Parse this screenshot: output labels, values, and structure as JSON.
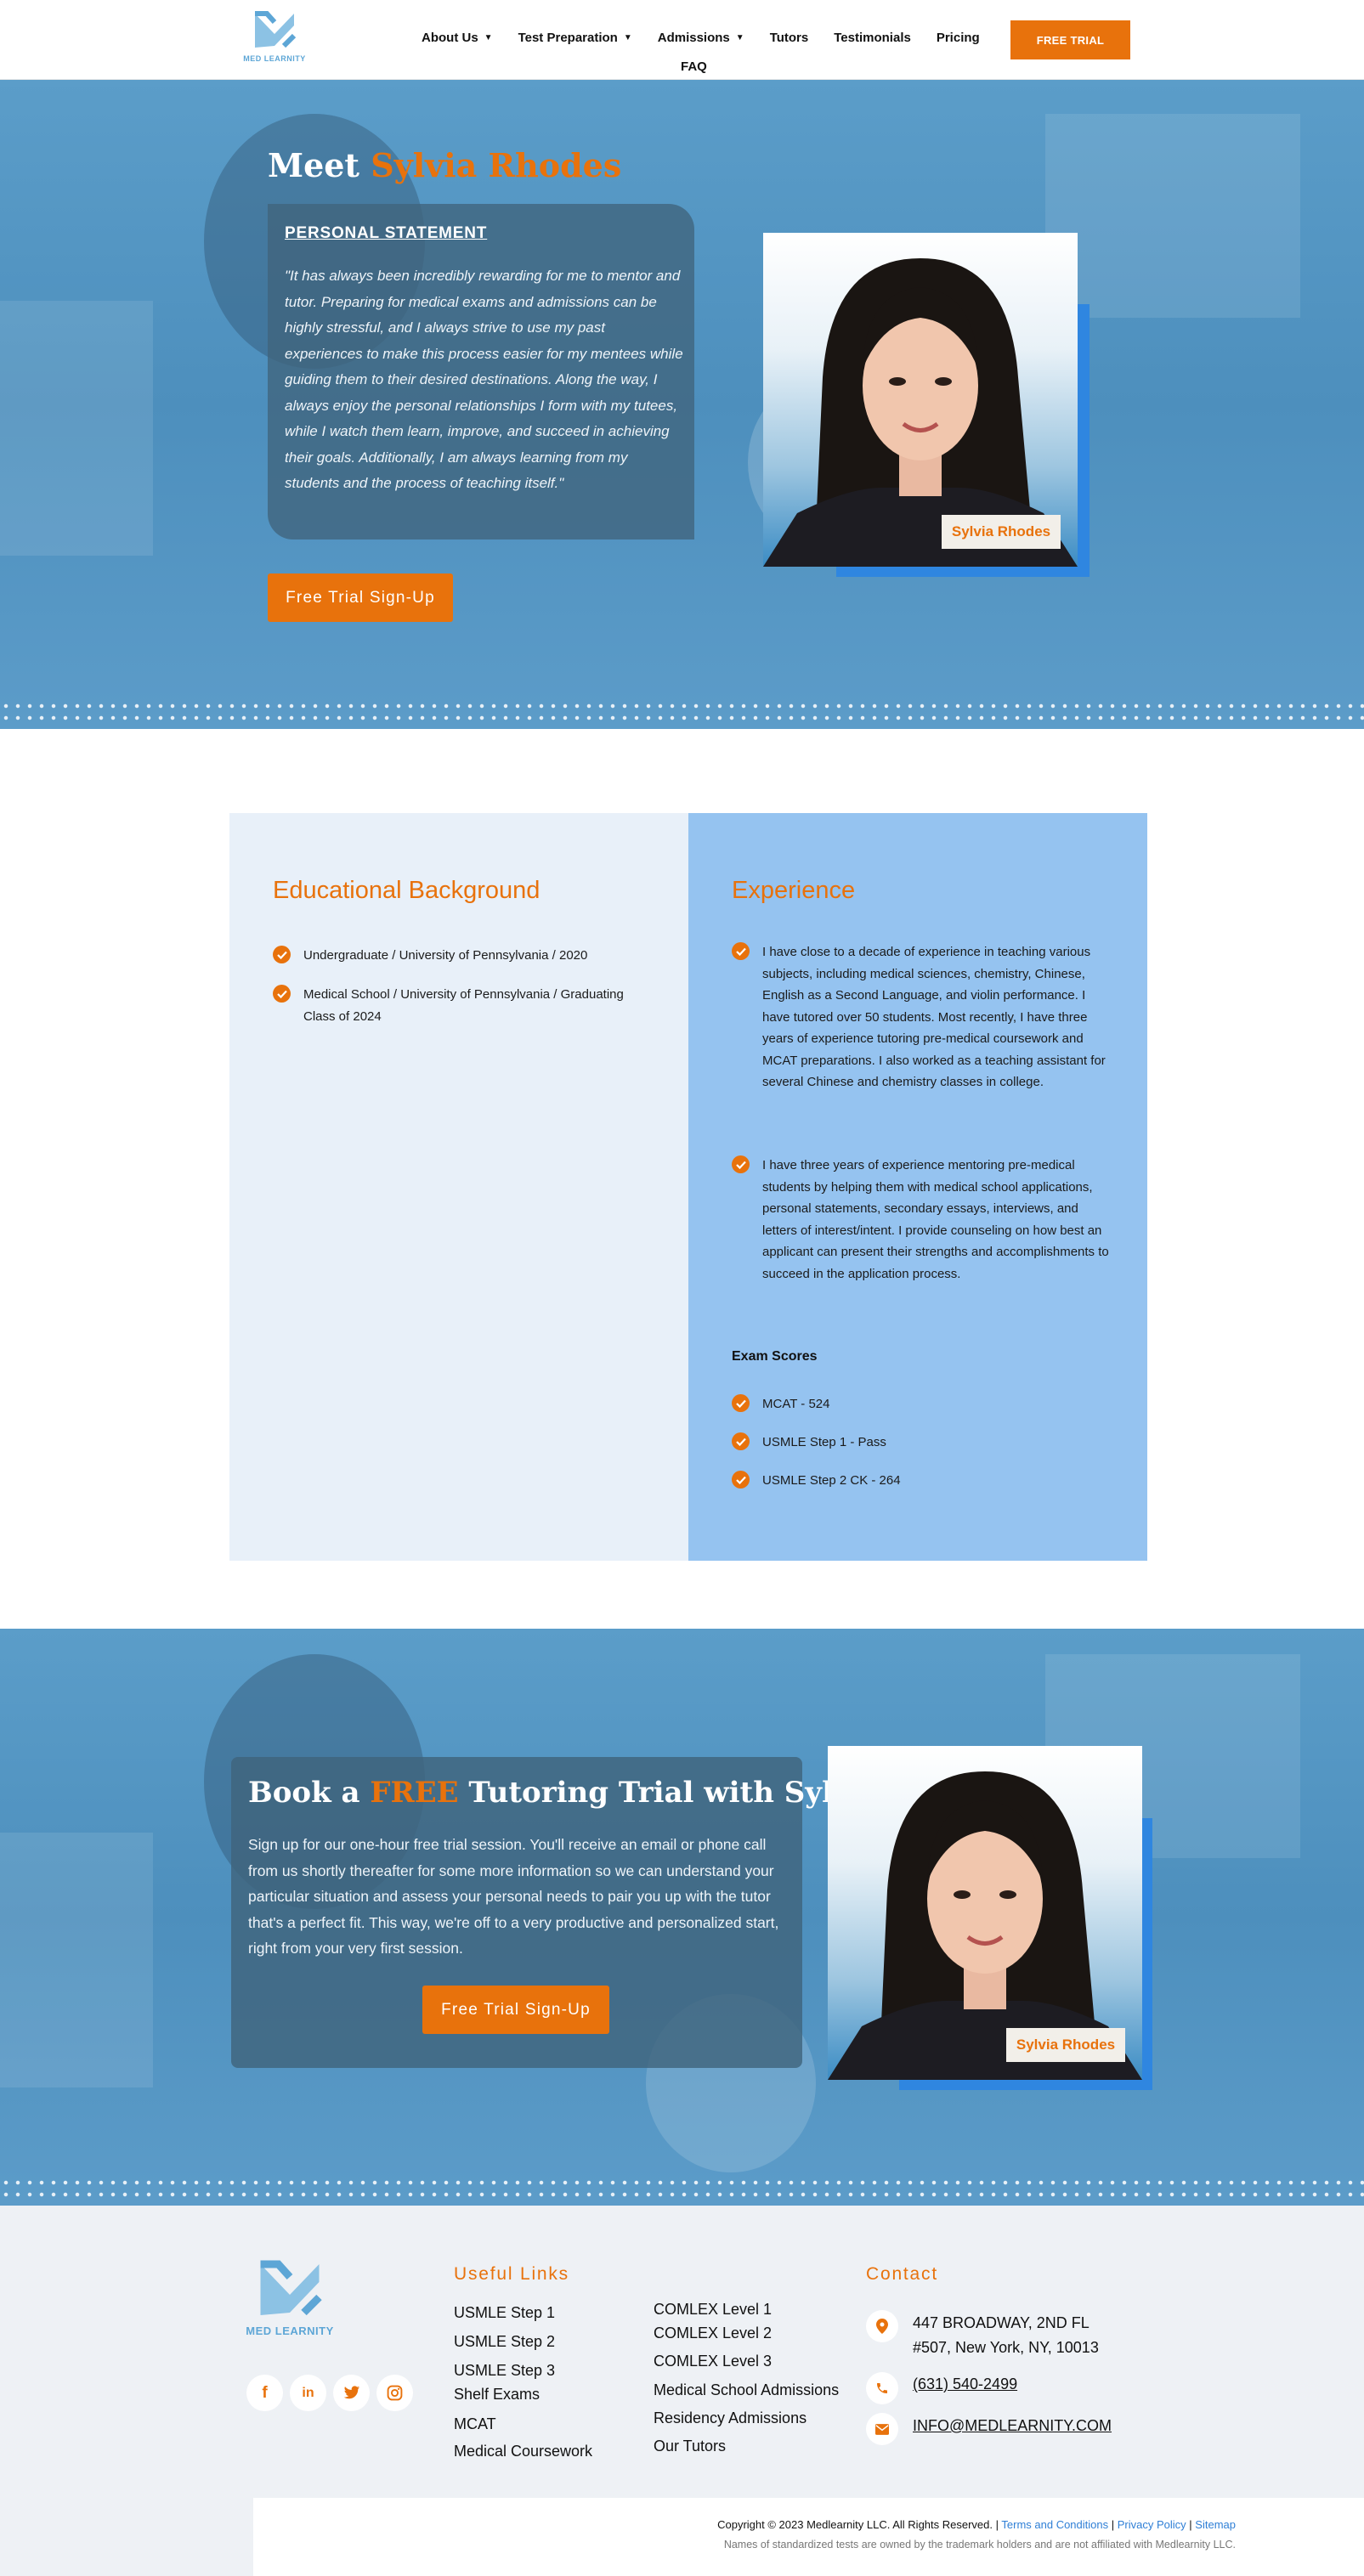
{
  "header": {
    "logo_text": "MED LEARNITY",
    "nav": [
      {
        "label": "About Us",
        "has_dropdown": true
      },
      {
        "label": "Test Preparation",
        "has_dropdown": true
      },
      {
        "label": "Admissions",
        "has_dropdown": true
      },
      {
        "label": "Tutors",
        "has_dropdown": false
      },
      {
        "label": "Testimonials",
        "has_dropdown": false
      },
      {
        "label": "Pricing",
        "has_dropdown": false
      },
      {
        "label": "FAQ",
        "has_dropdown": false
      }
    ],
    "cta_label": "FREE TRIAL"
  },
  "hero": {
    "title_prefix": "Meet ",
    "title_name": "Sylvia Rhodes",
    "statement_label": "PERSONAL STATEMENT",
    "statement": "\"It has always been incredibly rewarding for me to mentor and tutor. Preparing for medical exams and admissions can be highly stressful, and I always strive to use my past experiences to make this process easier for my mentees while guiding them to their desired destinations. Along the way, I always enjoy the personal relationships I form with my tutees, while I watch them learn, improve, and succeed in achieving their goals. Additionally, I am always learning from my students and the process of teaching itself.\"",
    "cta_label": "Free Trial Sign-Up",
    "photo_name_tag": "Sylvia Rhodes"
  },
  "education": {
    "heading": "Educational Background",
    "items": [
      "Undergraduate / University of Pennsylvania / 2020",
      "Medical School / University of Pennsylvania / Graduating Class of 2024"
    ]
  },
  "experience": {
    "heading": "Experience",
    "items": [
      "I have close to a decade of experience in teaching various subjects, including medical sciences, chemistry, Chinese, English as a Second Language, and violin performance. I have tutored over 50 students. Most recently, I have three years of experience tutoring pre-medical coursework and MCAT preparations. I also worked as a teaching assistant for several Chinese and chemistry classes in college.",
      "I have three years of experience mentoring pre-medical students by helping them with medical school applications, personal statements, secondary essays, interviews, and letters of interest/intent. I provide counseling on how best an applicant can present their strengths and accomplishments to succeed in the application process."
    ],
    "exam_heading": "Exam Scores",
    "exams": [
      "MCAT - 524",
      "USMLE Step 1 - Pass",
      "USMLE Step 2 CK - 264"
    ]
  },
  "booking": {
    "title_prefix": "Book a ",
    "title_accent": "FREE",
    "title_suffix": " Tutoring Trial with Sylvia",
    "text": "Sign up for our one-hour free trial session. You'll receive an email or phone call from us shortly thereafter for some more information so we can understand your particular situation and assess your personal needs to pair you up with the tutor that's a perfect fit. This way, we're off to a very productive and personalized start, right from your very first session.",
    "cta_label": "Free Trial Sign-Up",
    "photo_name_tag": "Sylvia Rhodes"
  },
  "footer": {
    "logo_text": "MED LEARNITY",
    "social": [
      {
        "icon": "facebook-icon",
        "glyph": "f"
      },
      {
        "icon": "linkedin-icon",
        "glyph": "in"
      },
      {
        "icon": "twitter-icon",
        "glyph": "t"
      },
      {
        "icon": "instagram-icon",
        "glyph": "◎"
      }
    ],
    "links_heading": "Useful Links",
    "links_col1": [
      "USMLE Step 1",
      "USMLE Step 2",
      "USMLE Step 3",
      "Shelf Exams",
      "MCAT",
      "Medical Coursework"
    ],
    "links_col2": [
      "COMLEX Level 1",
      "COMLEX Level 2",
      "COMLEX Level 3",
      "Medical School Admissions",
      "Residency Admissions",
      "Our Tutors"
    ],
    "contact_heading": "Contact",
    "address_line1": "447 BROADWAY, 2ND FL",
    "address_line2": "#507, New York, NY, 10013",
    "phone": "(631) 540-2499",
    "email": "INFO@MEDLEARNITY.COM",
    "copyright": "Copyright © 2023 Medlearnity LLC. All Rights Reserved.",
    "legal_links": [
      "Terms and Conditions",
      "Privacy Policy",
      "Sitemap"
    ],
    "disclaimer": "Names of standardized tests are owned by the trademark holders and are not affiliated with Medlearnity LLC."
  },
  "colors": {
    "accent": "#e8720c",
    "hero_blue": "#5b9dc9",
    "card_slate": "#40647c",
    "exp_blue": "#95c3f0",
    "edu_light": "#e8f0f9",
    "photo_frame": "#2f86e0"
  }
}
